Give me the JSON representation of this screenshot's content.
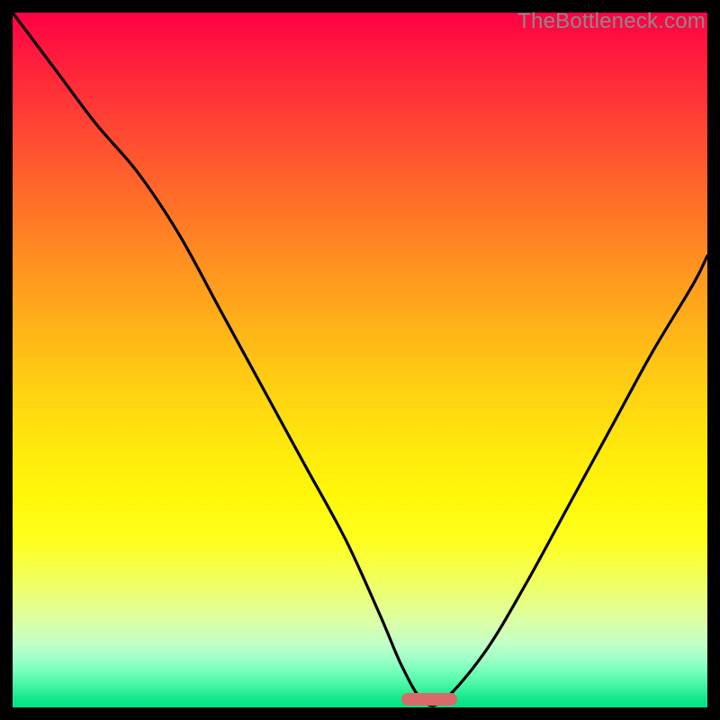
{
  "watermark": "TheBottleneck.com",
  "colors": {
    "frame": "#000000",
    "curve": "#000000",
    "marker": "#d96a6a"
  },
  "chart_data": {
    "type": "line",
    "title": "",
    "xlabel": "",
    "ylabel": "",
    "xlim": [
      0,
      100
    ],
    "ylim": [
      0,
      100
    ],
    "grid": false,
    "legend": false,
    "series": [
      {
        "name": "bottleneck-curve",
        "x": [
          0,
          6,
          12,
          18,
          24,
          30,
          36,
          42,
          48,
          53,
          56,
          59,
          62,
          68,
          74,
          80,
          86,
          92,
          98,
          100
        ],
        "y": [
          100,
          92,
          84,
          77,
          68,
          57,
          46,
          35,
          24,
          13,
          6,
          1,
          1,
          8,
          18,
          29,
          40,
          51,
          61,
          65
        ]
      }
    ],
    "annotations": [
      {
        "name": "optimal-range",
        "x_start": 56,
        "x_end": 64,
        "y": 0
      }
    ]
  }
}
